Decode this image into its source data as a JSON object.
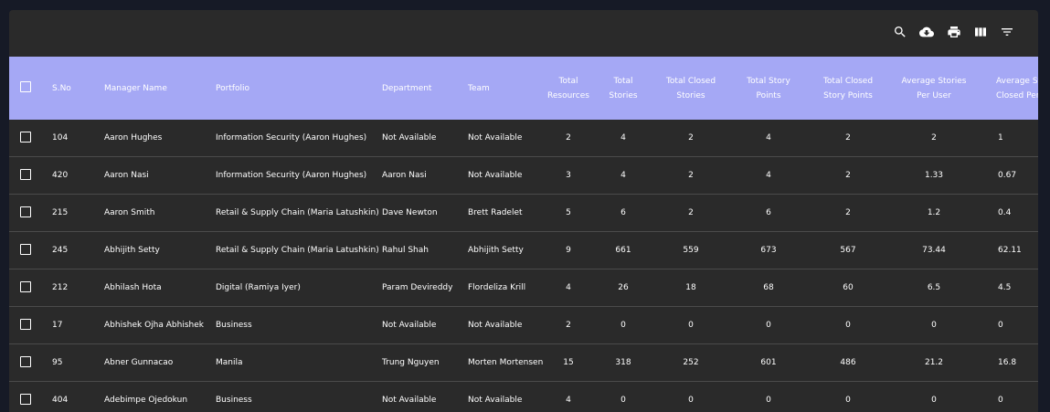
{
  "toolbar": {
    "icons": [
      "search-icon",
      "cloud-download-icon",
      "print-icon",
      "view-columns-icon",
      "filter-list-icon"
    ]
  },
  "columns": [
    {
      "key": "sno",
      "label": "S.No"
    },
    {
      "key": "manager",
      "label": "Manager Name"
    },
    {
      "key": "portfolio",
      "label": "Portfolio"
    },
    {
      "key": "department",
      "label": "Department"
    },
    {
      "key": "team",
      "label": "Team"
    },
    {
      "key": "total_resources",
      "label": "Total Resources"
    },
    {
      "key": "total_stories",
      "label": "Total Stories"
    },
    {
      "key": "total_closed_stories",
      "label": "Total Closed Stories"
    },
    {
      "key": "total_story_points",
      "label": "Total Story Points"
    },
    {
      "key": "total_closed_story_points",
      "label": "Total Closed Story Points"
    },
    {
      "key": "avg_stories_per_user",
      "label": "Average Stories Per User"
    },
    {
      "key": "avg_stories_closed_per_user",
      "label": "Average St Closed Per"
    }
  ],
  "rows": [
    {
      "sno": "104",
      "manager": "Aaron Hughes",
      "portfolio": "Information Security (Aaron Hughes)",
      "department": "Not Available",
      "team": "Not Available",
      "total_resources": "2",
      "total_stories": "4",
      "total_closed_stories": "2",
      "total_story_points": "4",
      "total_closed_story_points": "2",
      "avg_stories_per_user": "2",
      "avg_stories_closed_per_user": "1"
    },
    {
      "sno": "420",
      "manager": "Aaron Nasi",
      "portfolio": "Information Security (Aaron Hughes)",
      "department": "Aaron Nasi",
      "team": "Not Available",
      "total_resources": "3",
      "total_stories": "4",
      "total_closed_stories": "2",
      "total_story_points": "4",
      "total_closed_story_points": "2",
      "avg_stories_per_user": "1.33",
      "avg_stories_closed_per_user": "0.67"
    },
    {
      "sno": "215",
      "manager": "Aaron Smith",
      "portfolio": "Retail & Supply Chain (Maria Latushkin)",
      "department": "Dave Newton",
      "team": "Brett Radelet",
      "total_resources": "5",
      "total_stories": "6",
      "total_closed_stories": "2",
      "total_story_points": "6",
      "total_closed_story_points": "2",
      "avg_stories_per_user": "1.2",
      "avg_stories_closed_per_user": "0.4"
    },
    {
      "sno": "245",
      "manager": "Abhijith Setty",
      "portfolio": "Retail & Supply Chain (Maria Latushkin)",
      "department": "Rahul Shah",
      "team": "Abhijith Setty",
      "total_resources": "9",
      "total_stories": "661",
      "total_closed_stories": "559",
      "total_story_points": "673",
      "total_closed_story_points": "567",
      "avg_stories_per_user": "73.44",
      "avg_stories_closed_per_user": "62.11"
    },
    {
      "sno": "212",
      "manager": "Abhilash Hota",
      "portfolio": "Digital (Ramiya Iyer)",
      "department": "Param Devireddy",
      "team": "Flordeliza Krill",
      "total_resources": "4",
      "total_stories": "26",
      "total_closed_stories": "18",
      "total_story_points": "68",
      "total_closed_story_points": "60",
      "avg_stories_per_user": "6.5",
      "avg_stories_closed_per_user": "4.5"
    },
    {
      "sno": "17",
      "manager": "Abhishek Ojha Abhishek",
      "portfolio": "Business",
      "department": "Not Available",
      "team": "Not Available",
      "total_resources": "2",
      "total_stories": "0",
      "total_closed_stories": "0",
      "total_story_points": "0",
      "total_closed_story_points": "0",
      "avg_stories_per_user": "0",
      "avg_stories_closed_per_user": "0"
    },
    {
      "sno": "95",
      "manager": "Abner Gunnacao",
      "portfolio": "Manila",
      "department": "Trung Nguyen",
      "team": "Morten Mortensen",
      "total_resources": "15",
      "total_stories": "318",
      "total_closed_stories": "252",
      "total_story_points": "601",
      "total_closed_story_points": "486",
      "avg_stories_per_user": "21.2",
      "avg_stories_closed_per_user": "16.8"
    },
    {
      "sno": "404",
      "manager": "Adebimpe Ojedokun",
      "portfolio": "Business",
      "department": "Not Available",
      "team": "Not Available",
      "total_resources": "4",
      "total_stories": "0",
      "total_closed_stories": "0",
      "total_story_points": "0",
      "total_closed_story_points": "0",
      "avg_stories_per_user": "0",
      "avg_stories_closed_per_user": "0"
    }
  ],
  "colors": {
    "page_bg": "#161a26",
    "panel_bg": "#2a2a2a",
    "header_bg": "#a5a8f5",
    "text": "#ffffff",
    "row_divider": "#4b4b4b"
  }
}
